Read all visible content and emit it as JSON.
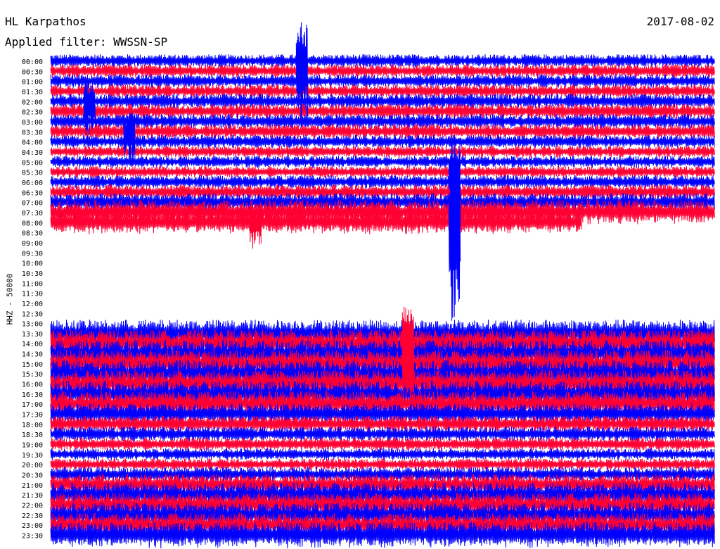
{
  "header": {
    "station": "HL Karpathos",
    "date": "2017-08-02",
    "filter": "Applied filter: WWSSN-SP"
  },
  "colors": {
    "trace_a": "#0000ff",
    "trace_b": "#ff0033",
    "background": "#ffffff"
  },
  "chart_data": {
    "type": "line",
    "title": "HL Karpathos",
    "ylabel": "HHZ - 50000",
    "grid": false,
    "series_colors": [
      "#0000ff",
      "#ff0033"
    ],
    "rows": [
      {
        "time": "00:00",
        "amp": 0.45,
        "color": "blue"
      },
      {
        "time": "00:30",
        "amp": 0.45,
        "color": "red"
      },
      {
        "time": "01:00",
        "amp": 0.45,
        "color": "blue"
      },
      {
        "time": "01:30",
        "amp": 0.45,
        "color": "red"
      },
      {
        "time": "02:00",
        "amp": 0.5,
        "color": "blue"
      },
      {
        "time": "02:30",
        "amp": 0.5,
        "color": "red"
      },
      {
        "time": "03:00",
        "amp": 0.5,
        "color": "blue"
      },
      {
        "time": "03:30",
        "amp": 0.5,
        "color": "red"
      },
      {
        "time": "04:00",
        "amp": 0.45,
        "color": "blue"
      },
      {
        "time": "04:30",
        "amp": 0.4,
        "color": "red"
      },
      {
        "time": "05:00",
        "amp": 0.4,
        "color": "blue"
      },
      {
        "time": "05:30",
        "amp": 0.4,
        "color": "red"
      },
      {
        "time": "06:00",
        "amp": 0.45,
        "color": "blue"
      },
      {
        "time": "06:30",
        "amp": 0.5,
        "color": "red"
      },
      {
        "time": "07:00",
        "amp": 0.6,
        "color": "blue"
      },
      {
        "time": "07:30",
        "amp": 0.8,
        "color": "red"
      },
      {
        "time": "08:00",
        "amp": 0.8,
        "color": "red",
        "end_fraction": 0.8
      },
      {
        "time": "08:30",
        "amp": 0,
        "color": "blue"
      },
      {
        "time": "09:00",
        "amp": 0,
        "color": "red"
      },
      {
        "time": "09:30",
        "amp": 0,
        "color": "blue"
      },
      {
        "time": "10:00",
        "amp": 0,
        "color": "red"
      },
      {
        "time": "10:30",
        "amp": 0,
        "color": "blue"
      },
      {
        "time": "11:00",
        "amp": 0,
        "color": "red"
      },
      {
        "time": "11:30",
        "amp": 0,
        "color": "blue"
      },
      {
        "time": "12:00",
        "amp": 0,
        "color": "red"
      },
      {
        "time": "12:30",
        "amp": 0,
        "color": "blue"
      },
      {
        "time": "13:00",
        "amp": 0,
        "color": "red"
      },
      {
        "time": "13:30",
        "amp": 0.9,
        "color": "blue"
      },
      {
        "time": "14:00",
        "amp": 0.9,
        "color": "red"
      },
      {
        "time": "14:30",
        "amp": 0.9,
        "color": "blue"
      },
      {
        "time": "15:00",
        "amp": 0.9,
        "color": "red"
      },
      {
        "time": "15:30",
        "amp": 0.9,
        "color": "blue"
      },
      {
        "time": "16:00",
        "amp": 0.9,
        "color": "red"
      },
      {
        "time": "16:30",
        "amp": 0.85,
        "color": "blue"
      },
      {
        "time": "17:00",
        "amp": 0.85,
        "color": "red"
      },
      {
        "time": "17:30",
        "amp": 0.7,
        "color": "blue"
      },
      {
        "time": "18:00",
        "amp": 0.55,
        "color": "red"
      },
      {
        "time": "18:30",
        "amp": 0.5,
        "color": "blue"
      },
      {
        "time": "19:00",
        "amp": 0.45,
        "color": "red"
      },
      {
        "time": "19:30",
        "amp": 0.4,
        "color": "blue"
      },
      {
        "time": "20:00",
        "amp": 0.4,
        "color": "red"
      },
      {
        "time": "20:30",
        "amp": 0.5,
        "color": "blue"
      },
      {
        "time": "21:00",
        "amp": 0.7,
        "color": "red"
      },
      {
        "time": "21:30",
        "amp": 0.8,
        "color": "blue"
      },
      {
        "time": "22:00",
        "amp": 0.8,
        "color": "red"
      },
      {
        "time": "22:30",
        "amp": 0.8,
        "color": "blue"
      },
      {
        "time": "23:00",
        "amp": 0.8,
        "color": "red"
      },
      {
        "time": "23:30",
        "amp": 0.85,
        "color": "blue"
      }
    ],
    "events": [
      {
        "time": "00:00",
        "x_fraction": 0.37,
        "height": 4.5,
        "color": "blue"
      },
      {
        "time": "02:00",
        "x_fraction": 0.05,
        "height": 2.2,
        "color": "blue"
      },
      {
        "time": "03:30",
        "x_fraction": 0.11,
        "height": 2.2,
        "color": "blue"
      },
      {
        "time": "05:30",
        "x_fraction": 0.6,
        "height": 3.5,
        "color": "blue"
      },
      {
        "time": "08:00",
        "x_fraction": 0.3,
        "height": 1.8,
        "color": "red"
      },
      {
        "time": "08:00",
        "x_fraction": 0.6,
        "height": 6.5,
        "color": "blue"
      },
      {
        "time": "13:30",
        "x_fraction": 0.53,
        "height": 3.0,
        "color": "red"
      },
      {
        "time": "15:00",
        "x_fraction": 0.53,
        "height": 2.5,
        "color": "red"
      }
    ]
  }
}
